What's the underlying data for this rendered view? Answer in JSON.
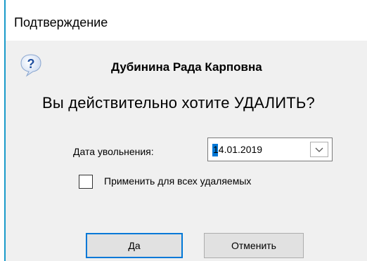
{
  "window": {
    "title": "Подтверждение"
  },
  "dialog": {
    "person_name": "Дубинина Рада Карповна",
    "question": "Вы действительно хотите УДАЛИТЬ?",
    "date_label": "Дата увольнения:",
    "date_value": "14.01.2019",
    "apply_all_label": "Применить для всех удаляемых",
    "apply_all_checked": false
  },
  "buttons": {
    "yes": "Да",
    "cancel": "Отменить"
  },
  "icons": {
    "question": "question-icon",
    "dropdown": "chevron-down-icon"
  },
  "colors": {
    "accent": "#0078d7",
    "window_border": "#1a9ac9",
    "dialog_bg": "#f0f0f0"
  }
}
